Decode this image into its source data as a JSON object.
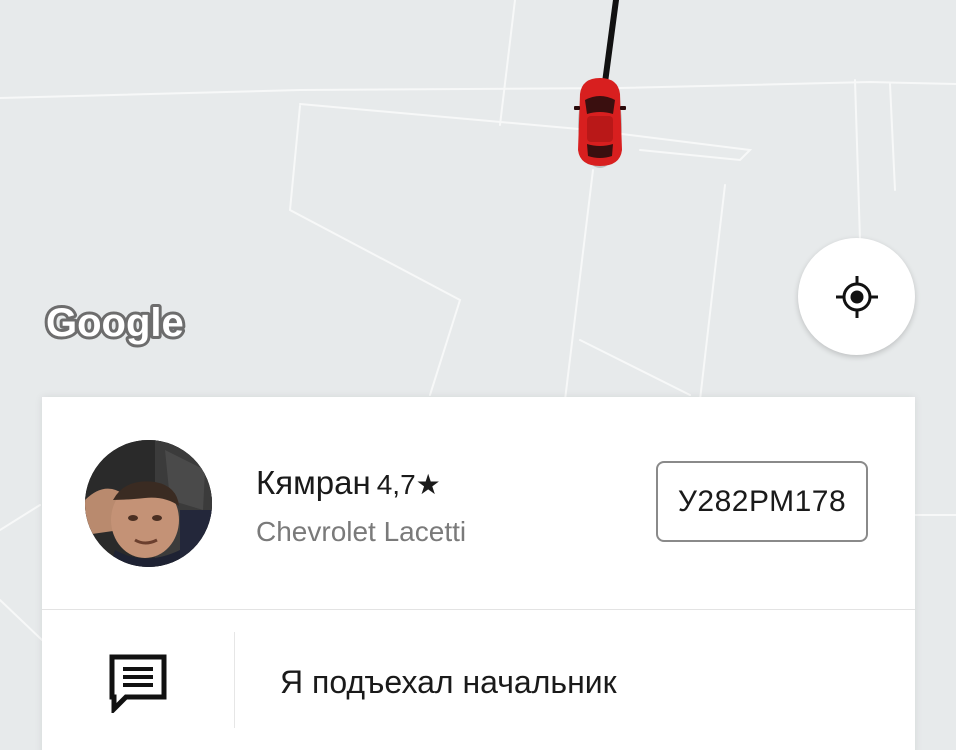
{
  "map": {
    "provider_logo_text": "Google",
    "locate_button_icon": "my-location-icon",
    "vehicle_icon": "car-icon",
    "colors": {
      "background": "#e7eaeb",
      "roads": "#ffffff",
      "route": "#111111",
      "car": "#d81f1f"
    }
  },
  "driver": {
    "name": "Кямран",
    "rating": "4,7★",
    "car_model": "Chevrolet Lacetti",
    "plate": "У282РМ178",
    "avatar_icon": "driver-avatar"
  },
  "chat": {
    "icon": "message-icon",
    "last_message": "Я подъехал начальник"
  }
}
